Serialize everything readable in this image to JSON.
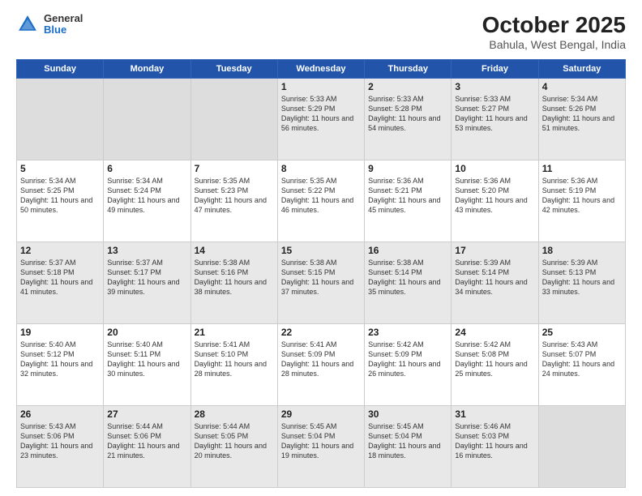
{
  "logo": {
    "general": "General",
    "blue": "Blue"
  },
  "header": {
    "month": "October 2025",
    "location": "Bahula, West Bengal, India"
  },
  "weekdays": [
    "Sunday",
    "Monday",
    "Tuesday",
    "Wednesday",
    "Thursday",
    "Friday",
    "Saturday"
  ],
  "weeks": [
    [
      {
        "day": "",
        "empty": true
      },
      {
        "day": "",
        "empty": true
      },
      {
        "day": "",
        "empty": true
      },
      {
        "day": "1",
        "sunrise": "Sunrise: 5:33 AM",
        "sunset": "Sunset: 5:29 PM",
        "daylight": "Daylight: 11 hours and 56 minutes."
      },
      {
        "day": "2",
        "sunrise": "Sunrise: 5:33 AM",
        "sunset": "Sunset: 5:28 PM",
        "daylight": "Daylight: 11 hours and 54 minutes."
      },
      {
        "day": "3",
        "sunrise": "Sunrise: 5:33 AM",
        "sunset": "Sunset: 5:27 PM",
        "daylight": "Daylight: 11 hours and 53 minutes."
      },
      {
        "day": "4",
        "sunrise": "Sunrise: 5:34 AM",
        "sunset": "Sunset: 5:26 PM",
        "daylight": "Daylight: 11 hours and 51 minutes."
      }
    ],
    [
      {
        "day": "5",
        "sunrise": "Sunrise: 5:34 AM",
        "sunset": "Sunset: 5:25 PM",
        "daylight": "Daylight: 11 hours and 50 minutes."
      },
      {
        "day": "6",
        "sunrise": "Sunrise: 5:34 AM",
        "sunset": "Sunset: 5:24 PM",
        "daylight": "Daylight: 11 hours and 49 minutes."
      },
      {
        "day": "7",
        "sunrise": "Sunrise: 5:35 AM",
        "sunset": "Sunset: 5:23 PM",
        "daylight": "Daylight: 11 hours and 47 minutes."
      },
      {
        "day": "8",
        "sunrise": "Sunrise: 5:35 AM",
        "sunset": "Sunset: 5:22 PM",
        "daylight": "Daylight: 11 hours and 46 minutes."
      },
      {
        "day": "9",
        "sunrise": "Sunrise: 5:36 AM",
        "sunset": "Sunset: 5:21 PM",
        "daylight": "Daylight: 11 hours and 45 minutes."
      },
      {
        "day": "10",
        "sunrise": "Sunrise: 5:36 AM",
        "sunset": "Sunset: 5:20 PM",
        "daylight": "Daylight: 11 hours and 43 minutes."
      },
      {
        "day": "11",
        "sunrise": "Sunrise: 5:36 AM",
        "sunset": "Sunset: 5:19 PM",
        "daylight": "Daylight: 11 hours and 42 minutes."
      }
    ],
    [
      {
        "day": "12",
        "sunrise": "Sunrise: 5:37 AM",
        "sunset": "Sunset: 5:18 PM",
        "daylight": "Daylight: 11 hours and 41 minutes."
      },
      {
        "day": "13",
        "sunrise": "Sunrise: 5:37 AM",
        "sunset": "Sunset: 5:17 PM",
        "daylight": "Daylight: 11 hours and 39 minutes."
      },
      {
        "day": "14",
        "sunrise": "Sunrise: 5:38 AM",
        "sunset": "Sunset: 5:16 PM",
        "daylight": "Daylight: 11 hours and 38 minutes."
      },
      {
        "day": "15",
        "sunrise": "Sunrise: 5:38 AM",
        "sunset": "Sunset: 5:15 PM",
        "daylight": "Daylight: 11 hours and 37 minutes."
      },
      {
        "day": "16",
        "sunrise": "Sunrise: 5:38 AM",
        "sunset": "Sunset: 5:14 PM",
        "daylight": "Daylight: 11 hours and 35 minutes."
      },
      {
        "day": "17",
        "sunrise": "Sunrise: 5:39 AM",
        "sunset": "Sunset: 5:14 PM",
        "daylight": "Daylight: 11 hours and 34 minutes."
      },
      {
        "day": "18",
        "sunrise": "Sunrise: 5:39 AM",
        "sunset": "Sunset: 5:13 PM",
        "daylight": "Daylight: 11 hours and 33 minutes."
      }
    ],
    [
      {
        "day": "19",
        "sunrise": "Sunrise: 5:40 AM",
        "sunset": "Sunset: 5:12 PM",
        "daylight": "Daylight: 11 hours and 32 minutes."
      },
      {
        "day": "20",
        "sunrise": "Sunrise: 5:40 AM",
        "sunset": "Sunset: 5:11 PM",
        "daylight": "Daylight: 11 hours and 30 minutes."
      },
      {
        "day": "21",
        "sunrise": "Sunrise: 5:41 AM",
        "sunset": "Sunset: 5:10 PM",
        "daylight": "Daylight: 11 hours and 28 minutes."
      },
      {
        "day": "22",
        "sunrise": "Sunrise: 5:41 AM",
        "sunset": "Sunset: 5:09 PM",
        "daylight": "Daylight: 11 hours and 28 minutes."
      },
      {
        "day": "23",
        "sunrise": "Sunrise: 5:42 AM",
        "sunset": "Sunset: 5:09 PM",
        "daylight": "Daylight: 11 hours and 26 minutes."
      },
      {
        "day": "24",
        "sunrise": "Sunrise: 5:42 AM",
        "sunset": "Sunset: 5:08 PM",
        "daylight": "Daylight: 11 hours and 25 minutes."
      },
      {
        "day": "25",
        "sunrise": "Sunrise: 5:43 AM",
        "sunset": "Sunset: 5:07 PM",
        "daylight": "Daylight: 11 hours and 24 minutes."
      }
    ],
    [
      {
        "day": "26",
        "sunrise": "Sunrise: 5:43 AM",
        "sunset": "Sunset: 5:06 PM",
        "daylight": "Daylight: 11 hours and 23 minutes."
      },
      {
        "day": "27",
        "sunrise": "Sunrise: 5:44 AM",
        "sunset": "Sunset: 5:06 PM",
        "daylight": "Daylight: 11 hours and 21 minutes."
      },
      {
        "day": "28",
        "sunrise": "Sunrise: 5:44 AM",
        "sunset": "Sunset: 5:05 PM",
        "daylight": "Daylight: 11 hours and 20 minutes."
      },
      {
        "day": "29",
        "sunrise": "Sunrise: 5:45 AM",
        "sunset": "Sunset: 5:04 PM",
        "daylight": "Daylight: 11 hours and 19 minutes."
      },
      {
        "day": "30",
        "sunrise": "Sunrise: 5:45 AM",
        "sunset": "Sunset: 5:04 PM",
        "daylight": "Daylight: 11 hours and 18 minutes."
      },
      {
        "day": "31",
        "sunrise": "Sunrise: 5:46 AM",
        "sunset": "Sunset: 5:03 PM",
        "daylight": "Daylight: 11 hours and 16 minutes."
      },
      {
        "day": "",
        "empty": true
      }
    ]
  ]
}
